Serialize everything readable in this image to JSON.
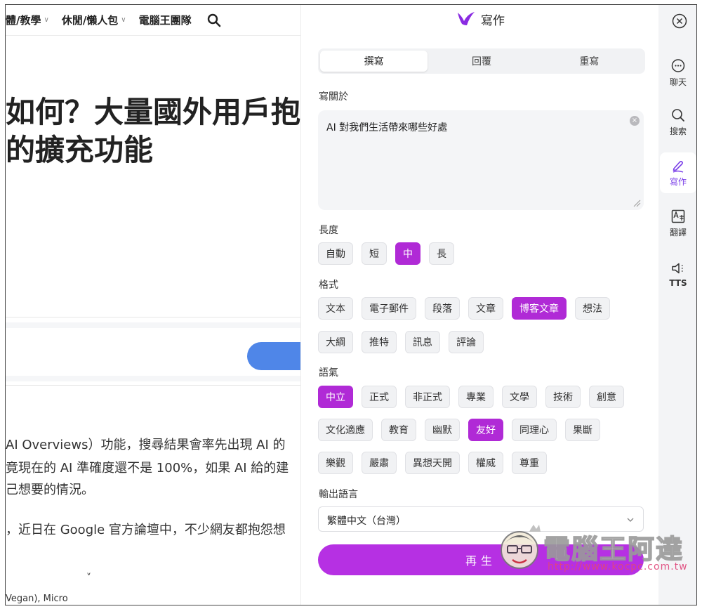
{
  "site": {
    "nav": [
      "體/教學",
      "休閒/懶人包",
      "電腦王團隊"
    ],
    "headline_line1": "如何？大量國外用戶抱",
    "headline_line2": "的擴充功能",
    "paragraphs": [
      "AI Overviews）功能，搜尋結果會率先出現 AI 的",
      "竟現在的 AI 準確度還不是 100%，如果 AI 給的建",
      "己想要的情況。",
      "，近日在 Google 官方論壇中，不少網友都抱怨想"
    ],
    "tail_text": "Vegan), Micro"
  },
  "panel": {
    "title": "寫作",
    "tabs": [
      {
        "label": "撰寫",
        "active": true
      },
      {
        "label": "回覆",
        "active": false
      },
      {
        "label": "重寫",
        "active": false
      }
    ],
    "topic_label": "寫關於",
    "topic_value": "AI 對我們生活帶來哪些好處",
    "length_label": "長度",
    "length_options": [
      {
        "label": "自動",
        "selected": false
      },
      {
        "label": "短",
        "selected": false
      },
      {
        "label": "中",
        "selected": true
      },
      {
        "label": "長",
        "selected": false
      }
    ],
    "format_label": "格式",
    "format_options_row1": [
      {
        "label": "文本",
        "selected": false
      },
      {
        "label": "電子郵件",
        "selected": false
      },
      {
        "label": "段落",
        "selected": false
      },
      {
        "label": "文章",
        "selected": false
      },
      {
        "label": "博客文章",
        "selected": true
      },
      {
        "label": "想法",
        "selected": false
      }
    ],
    "format_options_row2": [
      {
        "label": "大綱",
        "selected": false
      },
      {
        "label": "推特",
        "selected": false
      },
      {
        "label": "訊息",
        "selected": false
      },
      {
        "label": "評論",
        "selected": false
      }
    ],
    "tone_label": "語氣",
    "tone_options_row1": [
      {
        "label": "中立",
        "selected": true
      },
      {
        "label": "正式",
        "selected": false
      },
      {
        "label": "非正式",
        "selected": false
      },
      {
        "label": "專業",
        "selected": false
      },
      {
        "label": "文學",
        "selected": false
      },
      {
        "label": "技術",
        "selected": false
      },
      {
        "label": "創意",
        "selected": false
      }
    ],
    "tone_options_row2": [
      {
        "label": "文化適應",
        "selected": false
      },
      {
        "label": "教育",
        "selected": false
      },
      {
        "label": "幽默",
        "selected": false
      },
      {
        "label": "友好",
        "selected": true
      },
      {
        "label": "同理心",
        "selected": false
      },
      {
        "label": "果斷",
        "selected": false
      }
    ],
    "tone_options_row3": [
      {
        "label": "樂觀",
        "selected": false
      },
      {
        "label": "嚴肅",
        "selected": false
      },
      {
        "label": "異想天開",
        "selected": false
      },
      {
        "label": "權威",
        "selected": false
      },
      {
        "label": "尊重",
        "selected": false
      }
    ],
    "output_lang_label": "輸出語言",
    "output_lang_value": "繁體中文（台灣）",
    "regenerate_label": "再生",
    "accent_color": "#b02ad6"
  },
  "rail": {
    "items": [
      {
        "label": "聊天",
        "icon": "chat-icon",
        "active": false
      },
      {
        "label": "搜索",
        "icon": "search-icon",
        "active": false
      },
      {
        "label": "寫作",
        "icon": "pen-icon",
        "active": true
      },
      {
        "label": "翻譯",
        "icon": "translate-icon",
        "active": false
      },
      {
        "label": "TTS",
        "icon": "speaker-icon",
        "active": false
      }
    ]
  },
  "watermark": {
    "title": "電腦王阿達",
    "url": "http://www.kocpc.com.tw"
  }
}
